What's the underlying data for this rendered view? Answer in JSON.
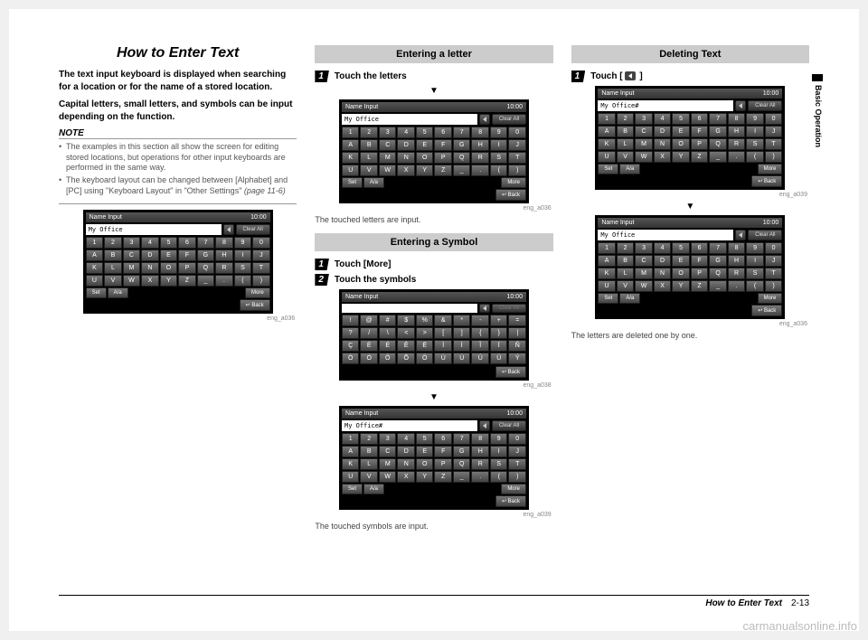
{
  "sideTab": "Basic Operation",
  "title": "How to Enter Text",
  "intro1": "The text input keyboard is displayed when searching for a location or for the name of a stored location.",
  "intro2": "Capital letters, small letters, and symbols can be input depending on the function.",
  "noteHead": "NOTE",
  "notes": [
    "The examples in this section all show the screen for editing stored locations, but operations for other input keyboards are performed in the same way.",
    "The keyboard layout can be changed between [Alphabet] and [PC] using \"Keyboard Layout\" in \"Other Settings\" "
  ],
  "pageRef": "(page 11-6)",
  "kbdCommon": {
    "title": "Name Input",
    "time": "10:00",
    "clear": "Clear All",
    "set": "Set",
    "case": "A/a",
    "more": "More",
    "back": "Back",
    "rowNum": [
      "1",
      "2",
      "3",
      "4",
      "5",
      "6",
      "7",
      "8",
      "9",
      "0"
    ],
    "rowA": [
      "A",
      "B",
      "C",
      "D",
      "E",
      "F",
      "G",
      "H",
      "I",
      "J"
    ],
    "rowK": [
      "K",
      "L",
      "M",
      "N",
      "O",
      "P",
      "Q",
      "R",
      "S",
      "T"
    ],
    "rowU": [
      "U",
      "V",
      "W",
      "X",
      "Y",
      "Z",
      "_",
      ".",
      "(",
      ")"
    ],
    "rowSym1": [
      "!",
      "@",
      "#",
      "$",
      "%",
      "&",
      "*",
      "-",
      "+",
      "="
    ],
    "rowSym2": [
      "?",
      "/",
      "\\",
      "<",
      ">",
      "[",
      "]",
      "{",
      "}",
      "|"
    ],
    "rowSym3": [
      "Ç",
      "È",
      "É",
      "Ê",
      "Ë",
      "Ì",
      "Í",
      "Î",
      "Ï",
      "Ñ"
    ],
    "rowSym4": [
      "Ò",
      "Ó",
      "Ô",
      "Õ",
      "Ö",
      "Ù",
      "Ú",
      "Û",
      "Ü",
      "Ý"
    ]
  },
  "kbd1": {
    "field": "My Office",
    "caption": "eng_a036"
  },
  "col2": {
    "h1": "Entering a letter",
    "s1": "Touch the letters",
    "kbdA": {
      "field": "My Office",
      "caption": "eng_a036"
    },
    "r1": "The touched letters are input.",
    "h2": "Entering a Symbol",
    "s2a": "Touch [More]",
    "s2b": "Touch the symbols",
    "kbdB": {
      "field": "",
      "caption": "eng_a038"
    },
    "kbdC": {
      "field": "My Office#",
      "caption": "eng_a039"
    },
    "r2": "The touched symbols are input."
  },
  "col3": {
    "h1": "Deleting Text",
    "s1pre": "Touch [",
    "s1post": " ]",
    "kbdA": {
      "field": "My Office#",
      "caption": "eng_a039"
    },
    "kbdB": {
      "field": "My Office",
      "caption": "eng_a036"
    },
    "r1": "The letters are deleted one by one."
  },
  "footer": {
    "title": "How to Enter Text",
    "page": "2-13"
  },
  "watermark": "carmanualsonline.info"
}
